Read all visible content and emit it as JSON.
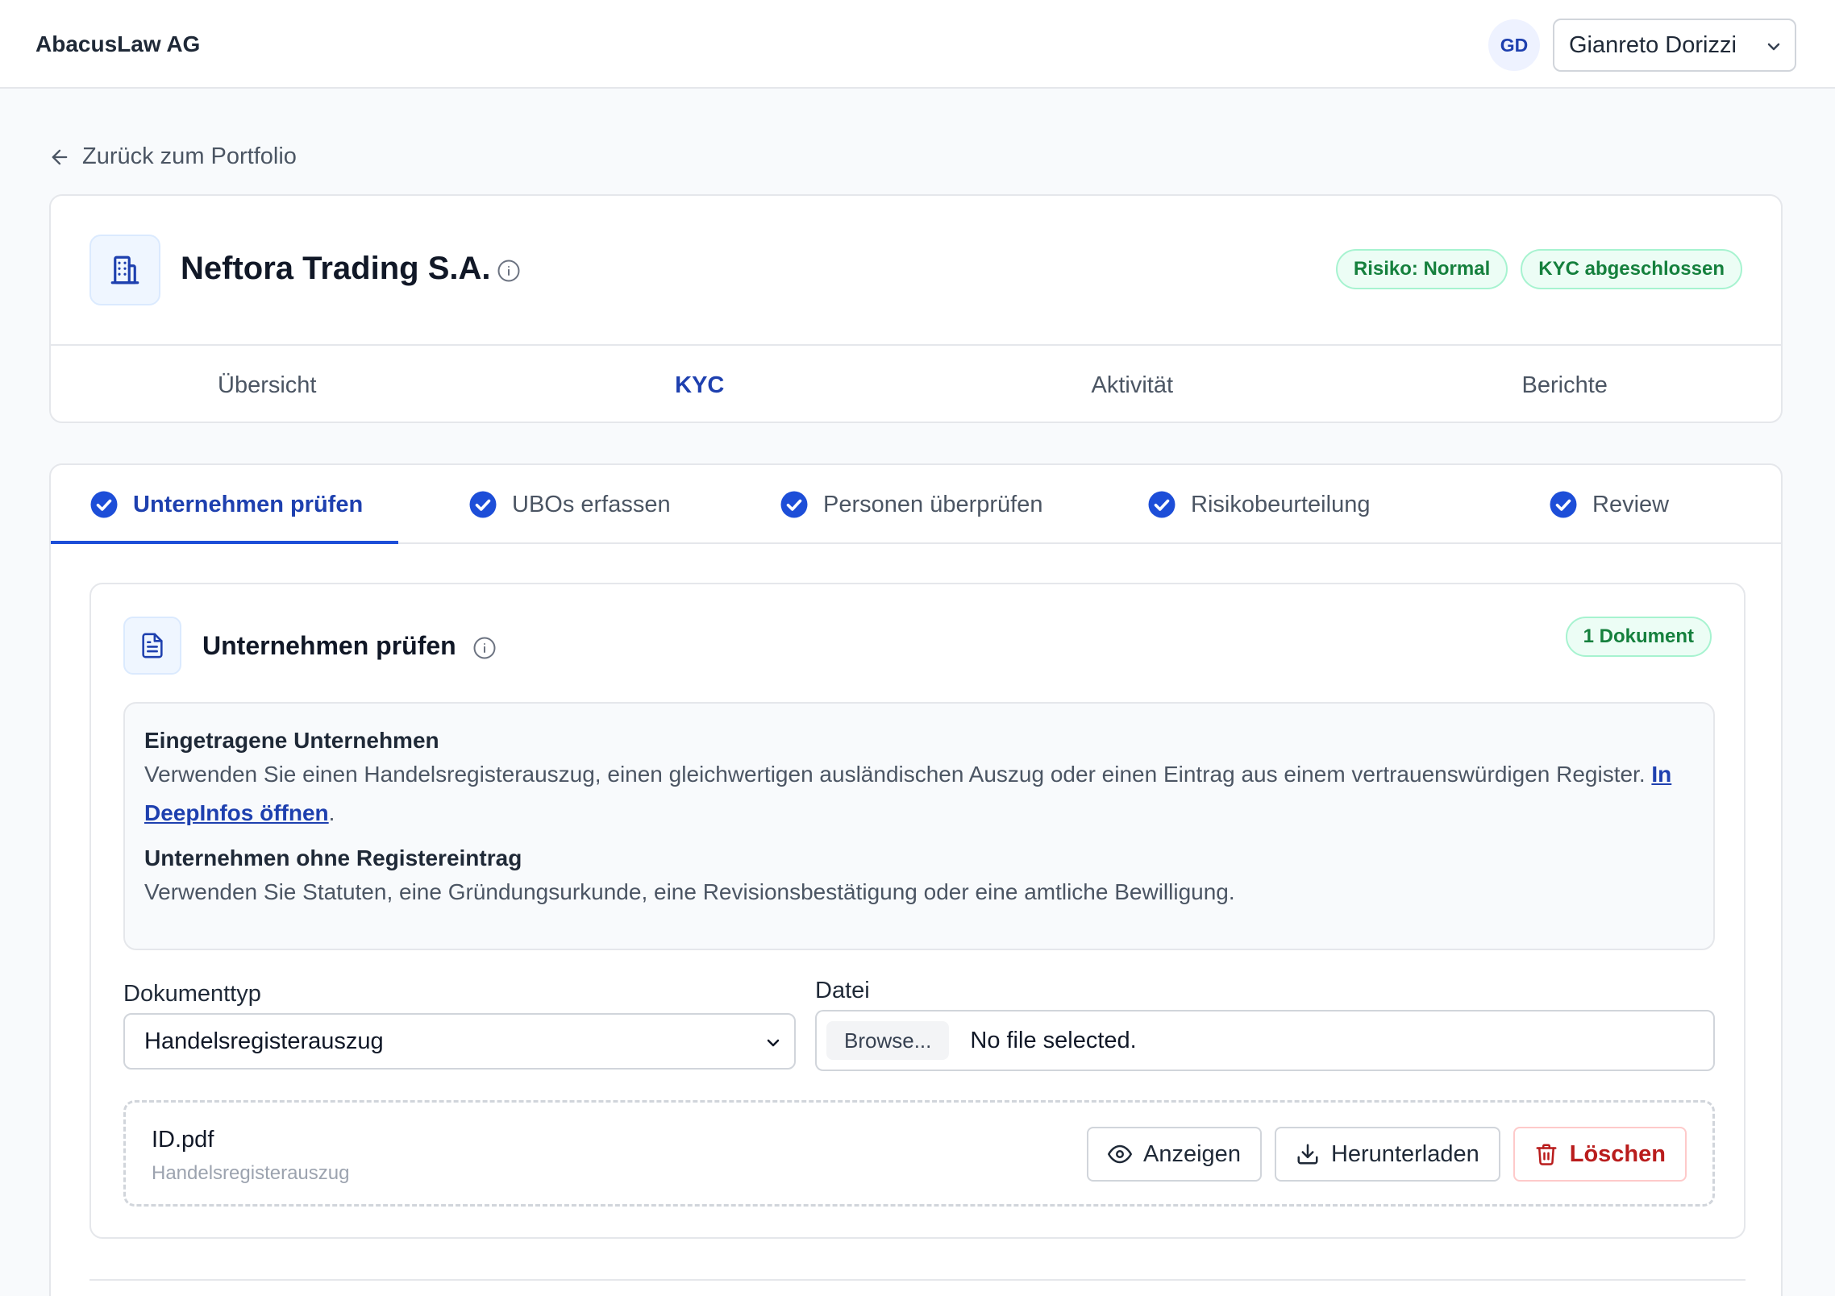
{
  "app": {
    "brand": "AbacusLaw AG"
  },
  "user": {
    "initials": "GD",
    "name": "Gianreto Dorizzi"
  },
  "nav": {
    "back_label": "Zurück zum Portfolio"
  },
  "company": {
    "name": "Neftora Trading S.A.",
    "badges": {
      "risk": "Risiko: Normal",
      "kyc": "KYC abgeschlossen"
    }
  },
  "main_tabs": [
    "Übersicht",
    "KYC",
    "Aktivität",
    "Berichte"
  ],
  "steps": [
    "Unternehmen prüfen",
    "UBOs erfassen",
    "Personen überprüfen",
    "Risikobeurteilung",
    "Review"
  ],
  "section": {
    "title": "Unternehmen prüfen",
    "doc_count": "1 Dokument",
    "registered_title": "Eingetragene Unternehmen",
    "registered_text": "Verwenden Sie einen Handelsregisterauszug, einen gleichwertigen ausländischen Auszug oder einen Eintrag aus einem vertrauenswürdigen Register.",
    "registered_link": "In DeepInfos öffnen",
    "registered_suffix": ".",
    "unregistered_title": "Unternehmen ohne Registereintrag",
    "unregistered_text": "Verwenden Sie Statuten, eine Gründungsurkunde, eine Revisionsbestätigung oder eine amtliche Bewilligung."
  },
  "form": {
    "doctype_label": "Dokumenttyp",
    "doctype_value": "Handelsregisterauszug",
    "file_label": "Datei",
    "browse_label": "Browse...",
    "file_status": "No file selected."
  },
  "uploaded_file": {
    "name": "ID.pdf",
    "type": "Handelsregisterauszug",
    "view_label": "Anzeigen",
    "download_label": "Herunterladen",
    "delete_label": "Löschen"
  },
  "colors": {
    "primary": "#1e40af",
    "success": "#15803d",
    "danger": "#b91c1c"
  }
}
